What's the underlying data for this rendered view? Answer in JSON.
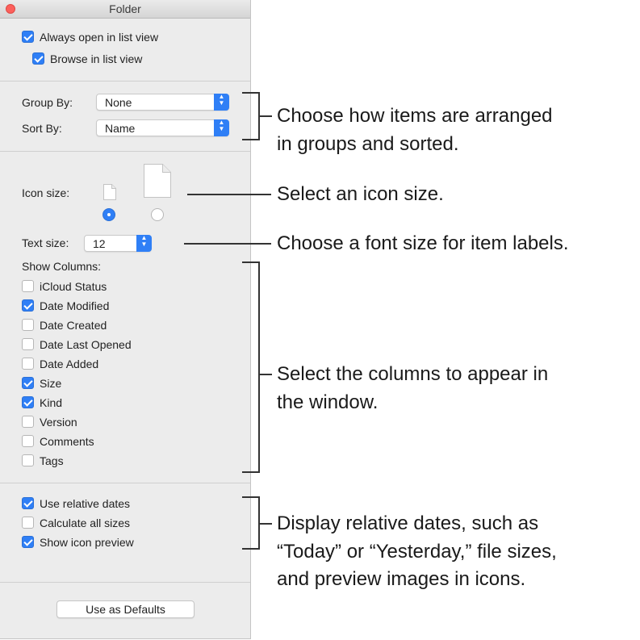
{
  "window": {
    "title": "Folder",
    "close_color": "#fc605c"
  },
  "top": {
    "always_open_label": "Always open in list view",
    "always_open_checked": true,
    "browse_label": "Browse in list view",
    "browse_checked": true
  },
  "grouping": {
    "group_by_label": "Group By:",
    "group_by_value": "None",
    "sort_by_label": "Sort By:",
    "sort_by_value": "Name"
  },
  "icon_size": {
    "label": "Icon size:",
    "selected": "small"
  },
  "text_size": {
    "label": "Text size:",
    "value": "12"
  },
  "columns": {
    "heading": "Show Columns:",
    "items": [
      {
        "label": "iCloud Status",
        "checked": false
      },
      {
        "label": "Date Modified",
        "checked": true
      },
      {
        "label": "Date Created",
        "checked": false
      },
      {
        "label": "Date Last Opened",
        "checked": false
      },
      {
        "label": "Date Added",
        "checked": false
      },
      {
        "label": "Size",
        "checked": true
      },
      {
        "label": "Kind",
        "checked": true
      },
      {
        "label": "Version",
        "checked": false
      },
      {
        "label": "Comments",
        "checked": false
      },
      {
        "label": "Tags",
        "checked": false
      }
    ]
  },
  "options": {
    "items": [
      {
        "label": "Use relative dates",
        "checked": true
      },
      {
        "label": "Calculate all sizes",
        "checked": false
      },
      {
        "label": "Show icon preview",
        "checked": true
      }
    ]
  },
  "defaults_button": "Use as Defaults",
  "callouts": {
    "arrange_line1": "Choose how items are arranged",
    "arrange_line2": "in groups and sorted.",
    "icon": "Select an icon size.",
    "font": "Choose a font size for item labels.",
    "columns_line1": "Select the columns to appear in",
    "columns_line2": "the window.",
    "dates_line1": "Display relative dates, such as",
    "dates_line2": "“Today” or “Yesterday,” file sizes,",
    "dates_line3": "and preview images in icons."
  },
  "colors": {
    "accent": "#2f7ff6",
    "window_bg": "#ececec"
  }
}
